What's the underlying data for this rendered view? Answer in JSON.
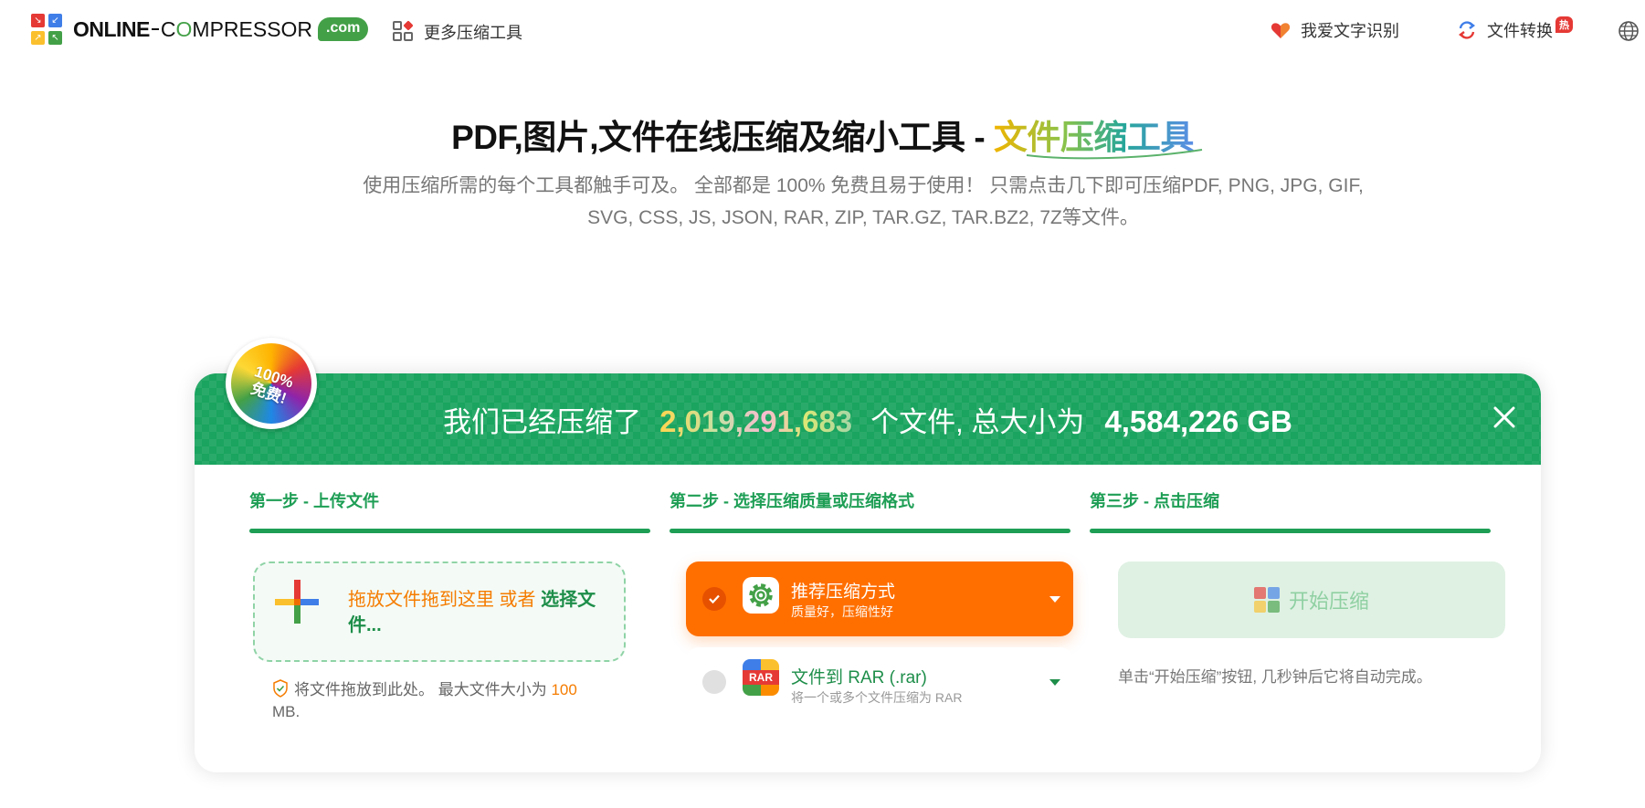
{
  "header": {
    "logo": {
      "part_bold": "ONLINE",
      "part_thin_c": "C",
      "part_thin_o": "O",
      "part_thin_rest": "MPRESSOR",
      "com": ".com"
    },
    "more_tools": "更多压缩工具",
    "nav": {
      "ocr": "我爱文字识别",
      "convert": "文件转换",
      "hot": "热"
    }
  },
  "hero": {
    "title_plain": "PDF,图片,文件在线压缩及缩小工具 - ",
    "title_highlight": "文件压缩工具",
    "subtitle": "使用压缩所需的每个工具都触手可及。 全部都是 100% 免费且易于使用！ 只需点击几下即可压缩PDF, PNG, JPG, GIF, SVG, CSS, JS, JSON, RAR, ZIP, TAR.GZ, TAR.BZ2, 7Z等文件。"
  },
  "badge": {
    "line1": "100%",
    "line2": "免费!"
  },
  "stats": {
    "prefix": "我们已经压缩了",
    "file_count": "2,019,291,683",
    "middle": "个文件, 总大小为",
    "total_size": "4,584,226 GB"
  },
  "steps": {
    "step1": "第一步 - 上传文件",
    "step2": "第二步 - 选择压缩质量或压缩格式",
    "step3": "第三步 - 点击压缩"
  },
  "upload": {
    "drop_text": "拖放文件拖到这里 或者 ",
    "choose_text": "选择文件...",
    "hint_text": "将文件拖放到此处。 最大文件大小为 ",
    "max_size": "100",
    "max_unit": " MB."
  },
  "formats": {
    "selected": {
      "title": "推荐压缩方式",
      "desc": "质量好，压缩性好"
    },
    "rar": {
      "title": "文件到 RAR (.rar)",
      "desc": "将一个或多个文件压缩为 RAR",
      "icon_text": "RAR"
    }
  },
  "compress": {
    "button": "开始压缩",
    "hint": "单击“开始压缩”按钮, 几秒钟后它将自动完成。"
  },
  "colors": {
    "green": "#1aa45f",
    "orange": "#ff6f00",
    "logo_red": "#e53935",
    "logo_blue": "#3f7ee8",
    "logo_yellow": "#fbc02d",
    "logo_green": "#43a047"
  },
  "icons": [
    "logo-grid-icon",
    "tools-grid-icon",
    "heart-icon",
    "convert-arrows-icon",
    "globe-icon",
    "close-icon",
    "plus-icon",
    "shield-check-icon",
    "check-icon",
    "gear-icon",
    "rar-icon",
    "chevron-down-icon",
    "compress-grid-icon"
  ]
}
